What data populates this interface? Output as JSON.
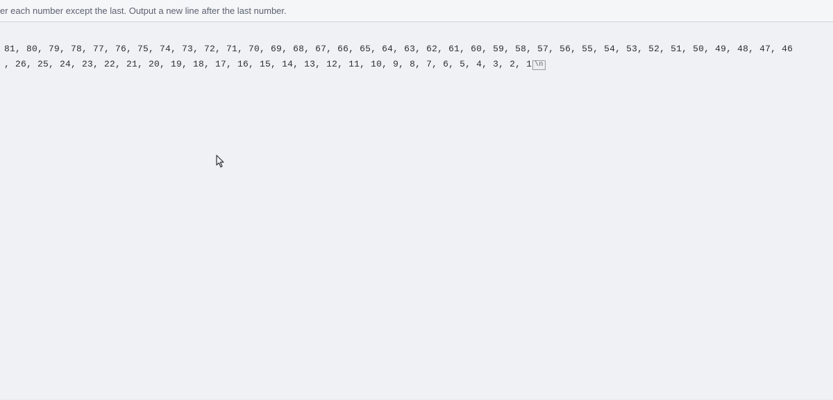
{
  "header": {
    "instruction": "er each number except the last. Output a new line after the last number."
  },
  "output": {
    "line1": " 81, 80, 79, 78, 77, 76, 75, 74, 73, 72, 71, 70, 69, 68, 67, 66, 65, 64, 63, 62, 61, 60, 59, 58, 57, 56, 55, 54, 53, 52, 51, 50, 49, 48, 47, 46",
    "line2": ", 26, 25, 24, 23, 22, 21, 20, 19, 18, 17, 16, 15, 14, 13, 12, 11, 10, 9, 8, 7, 6, 5, 4, 3, 2, 1",
    "newline_marker": "\\n"
  }
}
